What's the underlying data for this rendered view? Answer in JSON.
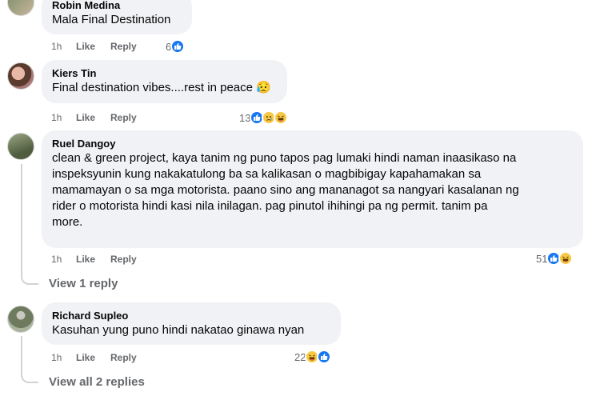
{
  "comments": [
    {
      "name": "Robin Medina",
      "text": "Mala Final Destination",
      "time": "1h",
      "like": "Like",
      "reply": "Reply",
      "reaction_count": "6",
      "reactions": [
        "like-icon"
      ]
    },
    {
      "name": "Kiers Tin",
      "text": "Final destination vibes....rest in peace 😥",
      "time": "1h",
      "like": "Like",
      "reply": "Reply",
      "reaction_count": "13",
      "reactions": [
        "like-icon",
        "sad-icon",
        "haha-icon"
      ]
    },
    {
      "name": "Ruel Dangoy",
      "text_lines": [
        "clean & green project, kaya tanim ng puno tapos pag lumaki hindi naman inaasikaso na",
        "inspeksyunin kung nakakatulong ba sa kalikasan o magbibigay kapahamakan sa",
        "mamamayan o sa mga motorista. paano sino ang mananagot sa nangyari kasalanan ng",
        "rider o motorista hindi kasi nila inilagan. pag pinutol ihihingi pa ng permit. tanim pa",
        "more."
      ],
      "time": "1h",
      "like": "Like",
      "reply": "Reply",
      "reaction_count": "51",
      "reactions": [
        "like-icon",
        "haha-icon"
      ],
      "view_replies": "View 1 reply"
    },
    {
      "name": "Richard Supleo",
      "text": "Kasuhan yung puno hindi nakatao ginawa nyan",
      "time": "1h",
      "like": "Like",
      "reply": "Reply",
      "reaction_count": "22",
      "reactions": [
        "haha-icon",
        "like-icon"
      ],
      "view_replies": "View all 2 replies"
    }
  ],
  "colors": {
    "bubble": "#f0f2f5",
    "secondary_text": "#65676b",
    "like_blue": "#1877f2",
    "emoji_yellow": "#f7c843"
  }
}
